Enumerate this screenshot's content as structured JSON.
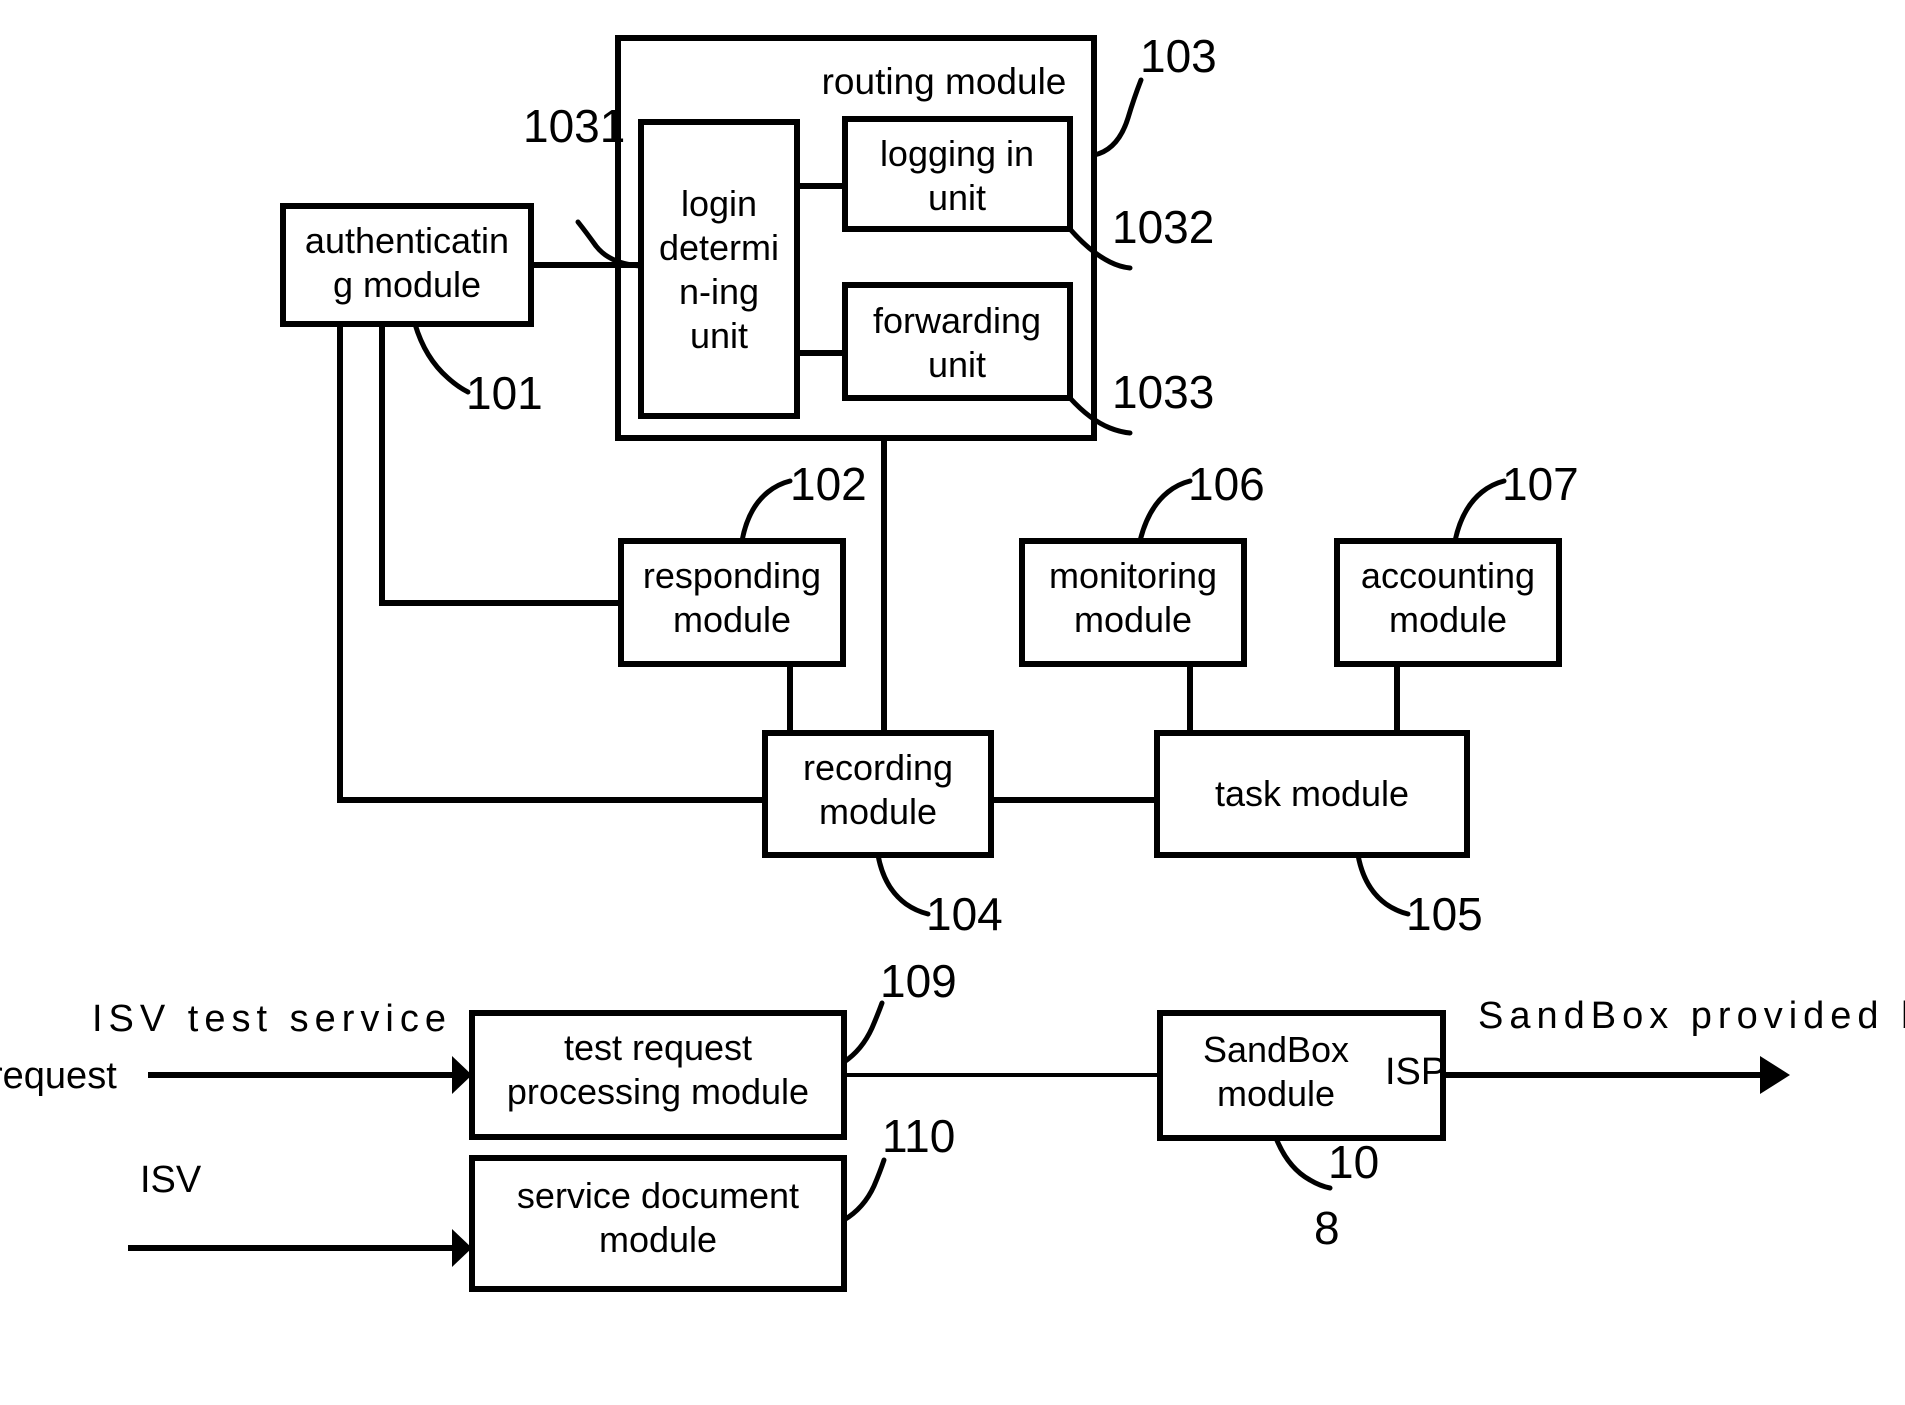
{
  "figure": {
    "type": "patent-block-diagram",
    "background_color": "#ffffff",
    "line_color": "#000000"
  },
  "upper_section": {
    "routing_module": {
      "title": "routing module",
      "ref": "103",
      "sub_units": [
        {
          "label": "login determi n-ing unit",
          "line1": "login",
          "line2": "determi",
          "line3": "n-ing",
          "line4": "unit",
          "ref": "1031"
        },
        {
          "label": "logging in unit",
          "line1": "logging in",
          "line2": "unit",
          "ref": "1032"
        },
        {
          "label": "forwarding unit",
          "line1": "forwarding",
          "line2": "unit",
          "ref": "1033"
        }
      ]
    },
    "modules": [
      {
        "name": "authenticating-module",
        "line1": "authenticatin",
        "line2": "g module",
        "ref": "101"
      },
      {
        "name": "responding-module",
        "line1": "responding",
        "line2": "module",
        "ref": "102"
      },
      {
        "name": "monitoring-module",
        "line1": "monitoring",
        "line2": "module",
        "ref": "106"
      },
      {
        "name": "accounting-module",
        "line1": "accounting",
        "line2": "module",
        "ref": "107"
      },
      {
        "name": "recording-module",
        "line1": "recording",
        "line2": "module",
        "ref": "104"
      },
      {
        "name": "task-module",
        "line1": "task module",
        "line2": "",
        "ref": "105"
      }
    ]
  },
  "lower_section": {
    "modules": [
      {
        "name": "test-request-processing-module",
        "line1": "test request",
        "line2": "processing module",
        "ref": "109"
      },
      {
        "name": "service-document-module",
        "line1": "service document",
        "line2": "module",
        "ref": "110"
      },
      {
        "name": "sandbox-module",
        "line1": "SandBox",
        "line2": "module",
        "ref": "10",
        "extra_ref": "8",
        "overlay_label": "ISP"
      }
    ],
    "flow_labels": {
      "test_request_line1": "ISV test service",
      "test_request_line2": "request",
      "isv_label": "ISV",
      "output_label": "SandBox provided by"
    }
  }
}
